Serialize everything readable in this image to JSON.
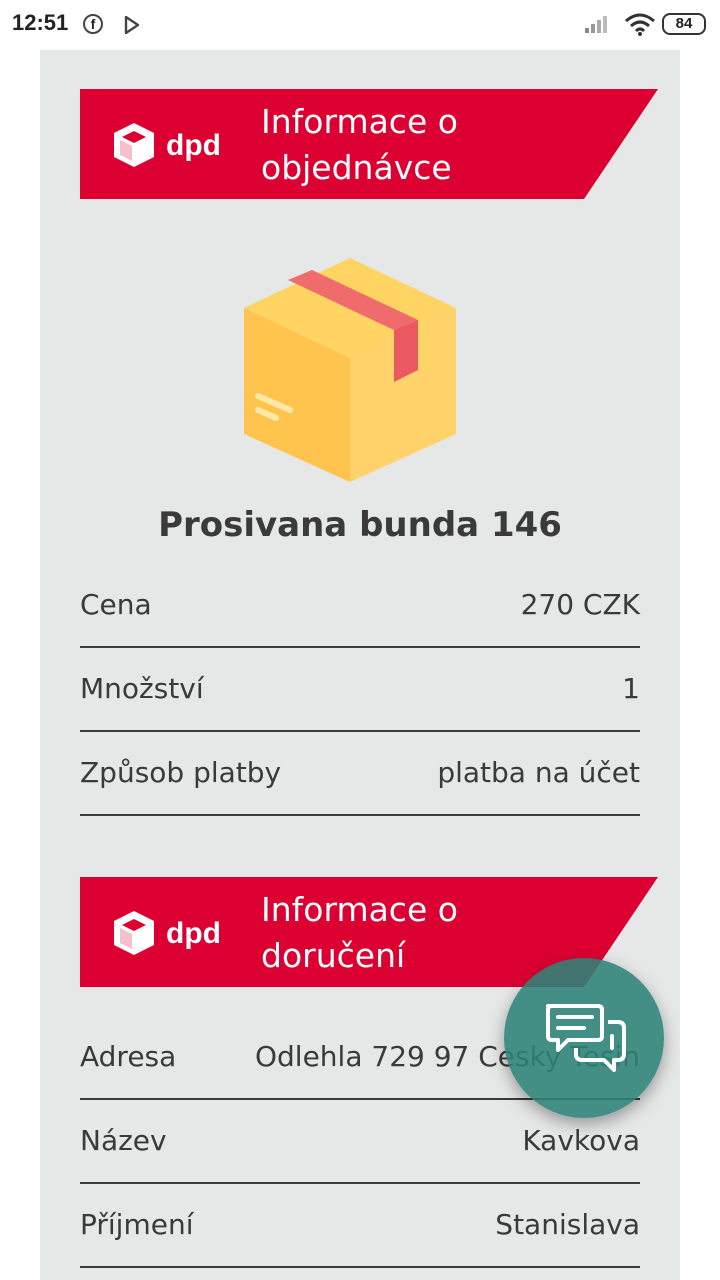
{
  "status_bar": {
    "time": "12:51",
    "facebook_icon": "f",
    "battery": "84"
  },
  "order_section": {
    "logo_text": "dpd",
    "title": "Informace o objednávce"
  },
  "product": {
    "name": "Prosivana bunda 146"
  },
  "order_rows": [
    {
      "label": "Cena",
      "value": "270 CZK"
    },
    {
      "label": "Množství",
      "value": "1"
    },
    {
      "label": "Způsob platby",
      "value": "platba na účet"
    }
  ],
  "delivery_section": {
    "logo_text": "dpd",
    "title": "Informace o doručení"
  },
  "delivery_rows": [
    {
      "label": "Adresa",
      "value": "Odlehla 729 97 Cesky Tesin"
    },
    {
      "label": "Název",
      "value": "Kavkova"
    },
    {
      "label": "Příjmení",
      "value": "Stanislava"
    }
  ],
  "colors": {
    "brand_red": "#dc0032",
    "panel_bg": "#e6e7e7",
    "fab_teal": "#2e8378",
    "text_dark": "#3a3a3a"
  },
  "icons": {
    "chat_fab": "chat-bubbles-icon",
    "box": "package-box-icon",
    "dpd": "dpd-cube-logo"
  }
}
